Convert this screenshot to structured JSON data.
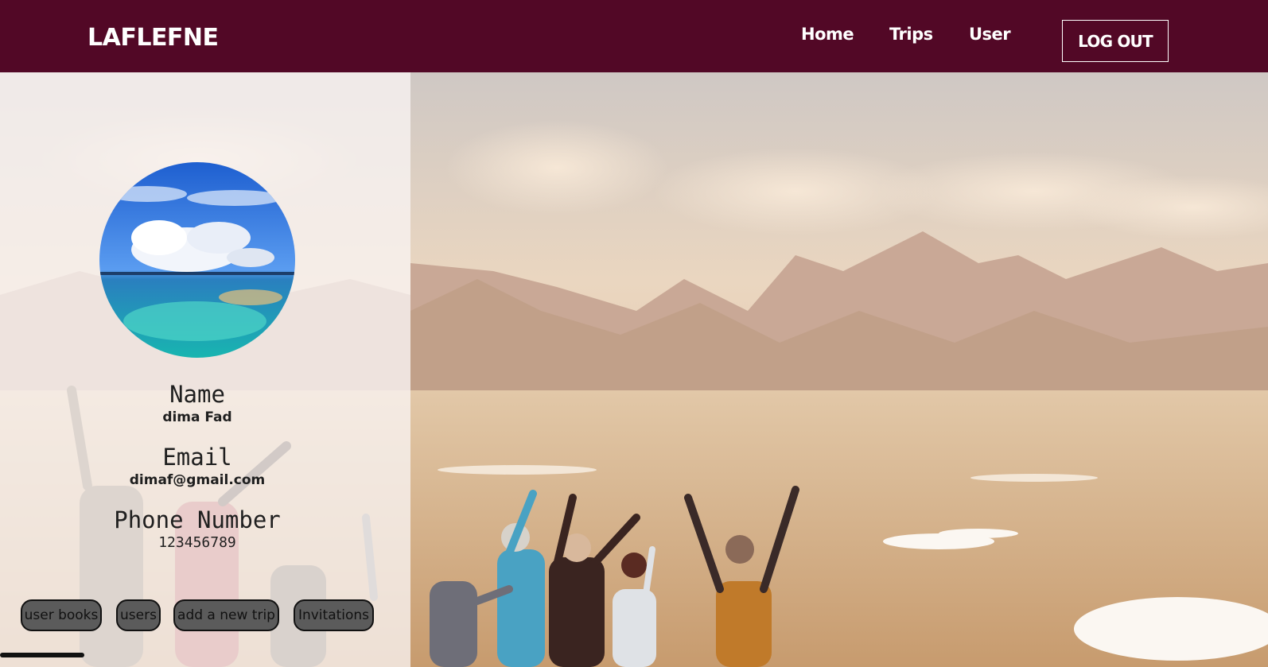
{
  "navbar": {
    "brand": "LAFLEFNE",
    "links": [
      {
        "label": "Home"
      },
      {
        "label": "Trips"
      },
      {
        "label": "User"
      }
    ],
    "logout_label": "LOG OUT"
  },
  "profile": {
    "name_label": "Name",
    "name_value": "dima Fad",
    "email_label": "Email",
    "email_value": "dimaf@gmail.com",
    "phone_label": "Phone Number",
    "phone_value": "123456789"
  },
  "actions": [
    {
      "label": "user books"
    },
    {
      "label": "users"
    },
    {
      "label": "add a new trip"
    },
    {
      "label": "Invitations"
    }
  ],
  "colors": {
    "navbar_bg": "#520826",
    "button_bg": "#5b5b5b",
    "panel_tint": "#f8f4f2"
  },
  "icons": {
    "avatar": "ocean-clouds-photo",
    "background": "mountain-hikers-photo"
  }
}
